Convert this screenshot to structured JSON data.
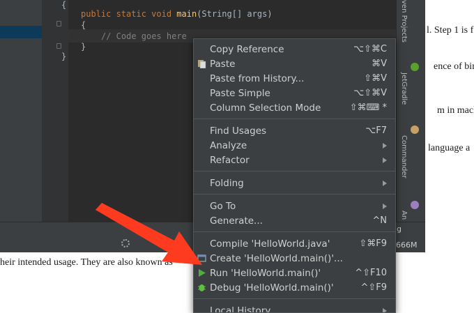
{
  "document": {
    "lines": [
      "l. Step 1 is f",
      "ence of bina",
      "m in machi",
      "language a",
      "heir intended usage. They are also known as"
    ]
  },
  "editor": {
    "code": {
      "open_brace": "{",
      "kw1": "public static void ",
      "fn": "main",
      "sig": "(String[] args)",
      "open_brace_inner": "{",
      "comment": "// Code goes here",
      "close_brace_inner": "}",
      "close_brace": "}"
    }
  },
  "tool_windows": {
    "right": [
      "ven Projects",
      "JetGradle",
      "Commander",
      "An"
    ]
  },
  "status": {
    "memory": "666M",
    "truncated": "g"
  },
  "context_menu": {
    "items": [
      {
        "label": "Copy Reference",
        "shortcut": "⌥⇧⌘C"
      },
      {
        "label": "Paste",
        "shortcut": "⌘V"
      },
      {
        "label": "Paste from History...",
        "shortcut": "⇧⌘V"
      },
      {
        "label": "Paste Simple",
        "shortcut": "⌥⇧⌘V"
      },
      {
        "label": "Column Selection Mode",
        "shortcut": "⇧⌘⌨ *"
      },
      {
        "label": "Find Usages",
        "shortcut": "⌥F7"
      },
      {
        "label": "Analyze",
        "shortcut": ""
      },
      {
        "label": "Refactor",
        "shortcut": ""
      },
      {
        "label": "Folding",
        "shortcut": ""
      },
      {
        "label": "Go To",
        "shortcut": ""
      },
      {
        "label": "Generate...",
        "shortcut": "^N"
      },
      {
        "label": "Compile 'HelloWorld.java'",
        "shortcut": "⇧⌘F9"
      },
      {
        "label": "Create 'HelloWorld.main()'...",
        "shortcut": ""
      },
      {
        "label": "Run 'HelloWorld.main()'",
        "shortcut": "^⇧F10"
      },
      {
        "label": "Debug 'HelloWorld.main()'",
        "shortcut": "^⇧F9"
      },
      {
        "label": "Local History",
        "shortcut": ""
      }
    ]
  },
  "colors": {
    "menu_bg": "#3c3f41",
    "annotation_arrow": "#ff3b1f",
    "run_icon": "#4fb03a",
    "debug_icon": "#5fbf3f"
  }
}
